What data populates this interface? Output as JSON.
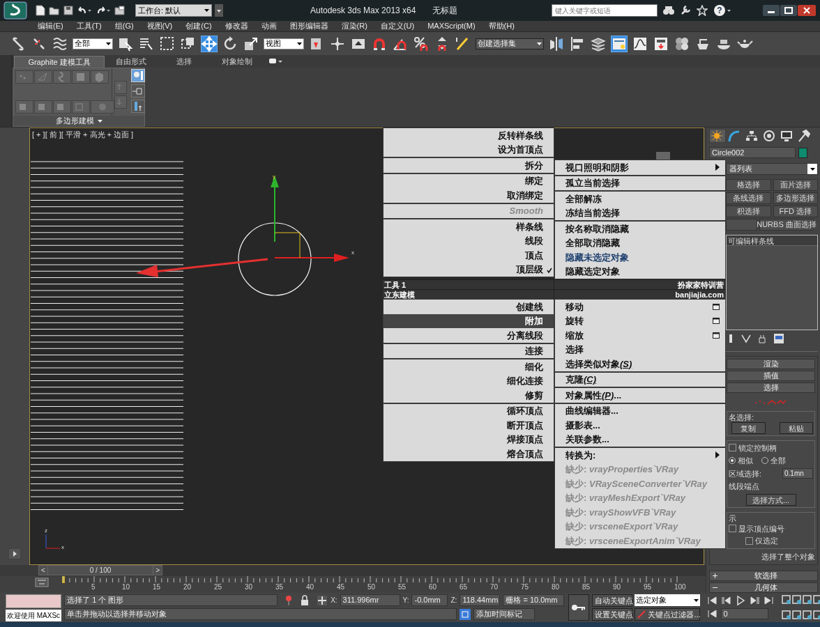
{
  "title_bar": {
    "workspace": "工作台: 默认",
    "title": "Autodesk 3ds Max  2013 x64",
    "document": "无标题",
    "search_placeholder": "键入关键字或短语",
    "help_icon": "?"
  },
  "menu_bar": [
    "编辑(E)",
    "工具(T)",
    "组(G)",
    "视图(V)",
    "创建(C)",
    "修改器",
    "动画",
    "图形编辑器",
    "渲染(R)",
    "自定义(U)",
    "MAXScript(M)",
    "帮助(H)"
  ],
  "main_toolbar": {
    "selection_filter": "全部",
    "reference_coord": "视图",
    "named_selection": "创建选择集"
  },
  "ribbon": {
    "tabs": [
      {
        "label": "Graphite 建模工具",
        "selected": true
      },
      {
        "label": "自由形式",
        "selected": false
      },
      {
        "label": "选择",
        "selected": false
      },
      {
        "label": "对象绘制",
        "selected": false
      }
    ],
    "panel_label": "多边形建模"
  },
  "viewport": {
    "label": "[ + ][ 前 ][ 平滑 + 高光 + 边面 ]",
    "gizmo_axes": [
      "y",
      "x"
    ],
    "corner_axes": [
      "z",
      "x"
    ]
  },
  "quad_menu": {
    "upper_left": [
      [
        {
          "label": "反转样条线",
          "selected": false,
          "disabled": false
        },
        {
          "label": "设为首顶点",
          "selected": false,
          "disabled": false
        }
      ],
      [
        {
          "label": "拆分",
          "selected": false,
          "disabled": false
        }
      ],
      [
        {
          "label": "绑定",
          "selected": false,
          "disabled": false
        },
        {
          "label": "取消绑定",
          "selected": false,
          "disabled": false
        }
      ],
      [
        {
          "label": "Smooth",
          "selected": false,
          "disabled": true
        }
      ],
      [
        {
          "label": "样条线",
          "selected": false,
          "disabled": false,
          "checked": false
        },
        {
          "label": "线段",
          "selected": false,
          "disabled": false,
          "checked": false
        },
        {
          "label": "顶点",
          "selected": false,
          "disabled": false,
          "checked": false
        },
        {
          "label": "顶层级",
          "selected": false,
          "disabled": false,
          "checked": true
        }
      ]
    ],
    "upper_right": [
      [
        {
          "label": "视口照明和阴影",
          "kind": "submenu",
          "selected": false,
          "disabled": false
        }
      ],
      [
        {
          "label": "孤立当前选择",
          "selected": false,
          "disabled": false
        }
      ],
      [
        {
          "label": "全部解冻",
          "selected": false,
          "disabled": false
        },
        {
          "label": "冻结当前选择",
          "selected": false,
          "disabled": false
        }
      ],
      [
        {
          "label": "按名称取消隐藏",
          "selected": false,
          "disabled": false,
          "highlighted": false
        },
        {
          "label": "全部取消隐藏",
          "selected": false,
          "disabled": false,
          "highlighted": false
        },
        {
          "label": "隐藏未选定对象",
          "selected": false,
          "disabled": false,
          "highlighted": true
        },
        {
          "label": "隐藏选定对象",
          "selected": false,
          "disabled": false,
          "highlighted": false
        }
      ]
    ],
    "headers": [
      {
        "left": "工具 1",
        "right": "扮家家特训营"
      },
      {
        "left": "立东建模",
        "right": "banjiajia.com"
      }
    ],
    "lower_left": [
      [
        {
          "label": "创建线",
          "selected": false,
          "disabled": false
        },
        {
          "label": "附加",
          "selected": true,
          "disabled": false
        },
        {
          "label": "分离线段",
          "selected": false,
          "disabled": false
        }
      ],
      [
        {
          "label": "连接",
          "selected": false,
          "disabled": false
        }
      ],
      [
        {
          "label": "细化",
          "selected": false,
          "disabled": false
        },
        {
          "label": "细化连接",
          "selected": false,
          "disabled": false
        },
        {
          "label": "修剪",
          "selected": false,
          "disabled": false
        }
      ],
      [
        {
          "label": "循环顶点",
          "selected": false,
          "disabled": false
        },
        {
          "label": "断开顶点",
          "selected": false,
          "disabled": false
        },
        {
          "label": "焊接顶点",
          "selected": false,
          "disabled": false
        },
        {
          "label": "熔合顶点",
          "selected": false,
          "disabled": false
        }
      ]
    ],
    "lower_right": [
      [
        {
          "label": "移动",
          "kind": "option",
          "selected": false,
          "disabled": false
        },
        {
          "label": "旋转",
          "kind": "option",
          "selected": false,
          "disabled": false
        },
        {
          "label": "缩放",
          "kind": "option",
          "selected": false,
          "disabled": false
        },
        {
          "label": "选择",
          "kind": "plain",
          "selected": false,
          "disabled": false
        },
        {
          "label": "选择类似对象",
          "accelerator": "(S)",
          "kind": "plain",
          "selected": false,
          "disabled": false
        }
      ],
      [
        {
          "label": "克隆",
          "accelerator": "(C)",
          "selected": false,
          "disabled": false
        }
      ],
      [
        {
          "label": "对象属性",
          "accelerator": "(P)",
          "suffix": "...",
          "selected": false,
          "disabled": false
        }
      ],
      [
        {
          "label": "曲线编辑器...",
          "selected": false,
          "disabled": false
        },
        {
          "label": "摄影表...",
          "selected": false,
          "disabled": false
        },
        {
          "label": "关联参数...",
          "selected": false,
          "disabled": false
        }
      ],
      [
        {
          "label": "转换为:",
          "kind": "submenu",
          "selected": false,
          "disabled": false
        },
        {
          "label": "缺少:",
          "plugin": "vrayProperties`VRay",
          "kind": "plain",
          "selected": false,
          "disabled": true
        },
        {
          "label": "缺少:",
          "plugin": "VRaySceneConverter`VRay",
          "kind": "plain",
          "selected": false,
          "disabled": true
        },
        {
          "label": "缺少:",
          "plugin": "vrayMeshExport`VRay",
          "kind": "plain",
          "selected": false,
          "disabled": true
        },
        {
          "label": "缺少:",
          "plugin": "vrayShowVFB`VRay",
          "kind": "plain",
          "selected": false,
          "disabled": true
        },
        {
          "label": "缺少:",
          "plugin": "vrsceneExport`VRay",
          "kind": "plain",
          "selected": false,
          "disabled": true
        },
        {
          "label": "缺少:",
          "plugin": "vrsceneExportAnim`VRay",
          "kind": "plain",
          "selected": false,
          "disabled": true
        }
      ]
    ]
  },
  "command_panel": {
    "tabs": [
      {
        "selected": true
      },
      {
        "selected": false
      },
      {
        "selected": false
      },
      {
        "selected": false
      },
      {
        "selected": false
      },
      {
        "selected": false
      }
    ],
    "object_name": "Circle002",
    "modifier_list": "器列表",
    "modifier_buttons": [
      [
        "格选择",
        "面片选择"
      ],
      [
        "条线选择",
        "多边形选择"
      ],
      [
        "积选择",
        "FFD 选择"
      ],
      [
        "NURBS 曲面选择"
      ]
    ],
    "stack": [
      "可编辑样条线"
    ],
    "upper_rollouts": [
      "渲染",
      "插值",
      "选择"
    ],
    "selection": {
      "named_selection_label": "名选择:",
      "copy": "复制",
      "paste": "粘贴",
      "lock_handles": {
        "label": "锁定控制柄",
        "checked": false
      },
      "handle_mode": [
        {
          "label": "相似",
          "selected": true
        },
        {
          "label": "全部",
          "selected": false
        }
      ],
      "area_selection": {
        "label": "区域选择:",
        "value": "0.1mn"
      },
      "segment_end_label": "线段端点",
      "select_by": "选择方式...",
      "display_label": "示",
      "show_vertex_numbers": {
        "label": "显示顶点编号",
        "checked": false
      },
      "selected_only": {
        "label": "仅选定",
        "checked": false
      },
      "status": "选择了整个对象"
    },
    "lower_rollouts": [
      {
        "label": "软选择",
        "expanded": false
      },
      {
        "label": "几何体",
        "expanded": true
      }
    ]
  },
  "timeline": {
    "slider": "0 / 100",
    "level": 0,
    "prev": "<",
    "next": ">",
    "ruler_labels": [
      "5",
      "10",
      "15",
      "20",
      "25",
      "30",
      "35",
      "40",
      "45",
      "50",
      "55",
      "60",
      "65",
      "70",
      "75",
      "80",
      "85",
      "90",
      "95",
      "100"
    ]
  },
  "status_bar": {
    "listener_output": "欢迎使用 MAXSc",
    "prompt": "选择了 1 个 图形",
    "hint": "单击并拖动以选择并移动对象",
    "coords": [
      {
        "axis": "X:",
        "value": "311.996mr"
      },
      {
        "axis": "Y:",
        "value": "-0.0mm"
      },
      {
        "axis": "Z:",
        "value": "118.44mm"
      }
    ],
    "grid": "栅格 = 10.0mm",
    "add_time_tag": "添加时间标记",
    "auto_key": "自动关键点",
    "key_mode": "选定对象",
    "set_key": "设置关键点",
    "key_filters": "关键点过滤器...",
    "frame": "0"
  }
}
